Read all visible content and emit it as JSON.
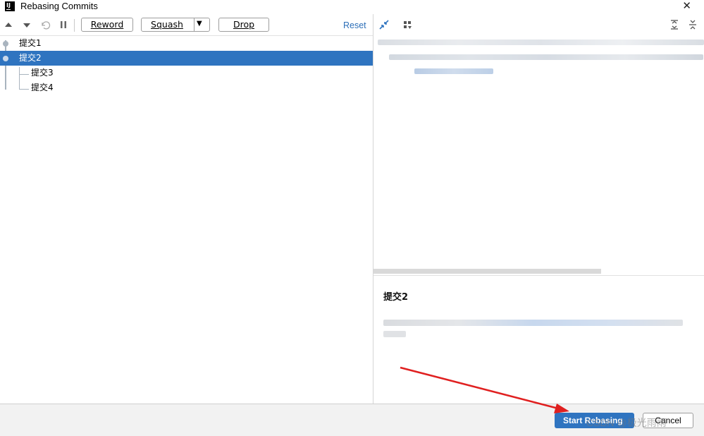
{
  "window": {
    "title": "Rebasing Commits",
    "close_glyph": "✕"
  },
  "toolbar": {
    "reword_label": "Reword",
    "squash_label": "Squash",
    "drop_label": "Drop",
    "reset_label": "Reset",
    "icons": [
      "move-up-icon",
      "move-down-icon",
      "undo-icon",
      "pause-icon",
      "squash-dropdown-caret-icon"
    ]
  },
  "commits": [
    {
      "label": "提交1",
      "selected": false
    },
    {
      "label": "提交2",
      "selected": true
    },
    {
      "label": "提交3",
      "selected": false
    },
    {
      "label": "提交4",
      "selected": false
    }
  ],
  "right_toolbar": {
    "icons": [
      "collapse-icon",
      "group-by-icon",
      "expand-all-icon",
      "collapse-all-icon"
    ]
  },
  "details": {
    "commit_title": "提交2"
  },
  "footer": {
    "start_label": "Start Rebasing",
    "cancel_label": "Cancel",
    "watermark": "CSDN @极光雨雨"
  },
  "colors": {
    "accent": "#2f74c0",
    "annotation_arrow": "#e02020"
  }
}
